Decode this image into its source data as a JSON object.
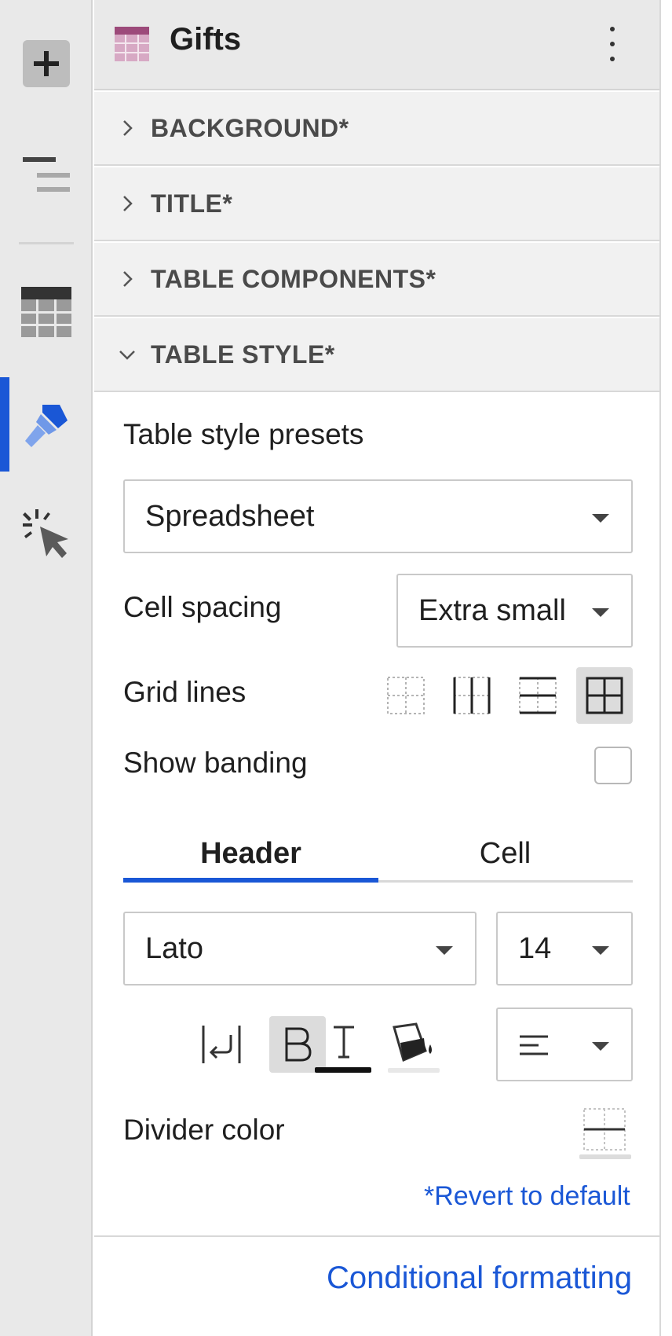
{
  "rail": {
    "items": [
      {
        "name": "add",
        "icon": "plus-icon"
      },
      {
        "name": "outline",
        "icon": "outline-lines-icon"
      },
      {
        "name": "table",
        "icon": "table-icon"
      },
      {
        "name": "format",
        "icon": "paintbrush-icon",
        "active": true
      },
      {
        "name": "actions",
        "icon": "cursor-click-icon"
      }
    ]
  },
  "header": {
    "title": "Gifts",
    "icon": "table-icon"
  },
  "sections": [
    {
      "label": "BACKGROUND*",
      "expanded": false
    },
    {
      "label": "TITLE*",
      "expanded": false
    },
    {
      "label": "TABLE COMPONENTS*",
      "expanded": false
    },
    {
      "label": "TABLE STYLE*",
      "expanded": true
    }
  ],
  "table_style": {
    "presets_label": "Table style presets",
    "preset_value": "Spreadsheet",
    "cell_spacing_label": "Cell spacing",
    "cell_spacing_value": "Extra small",
    "grid_lines_label": "Grid lines",
    "grid_options": [
      "none",
      "vertical",
      "horizontal",
      "all"
    ],
    "grid_selected": "all",
    "show_banding_label": "Show banding",
    "show_banding_checked": false,
    "tabs": [
      {
        "label": "Header",
        "active": true
      },
      {
        "label": "Cell",
        "active": false
      }
    ],
    "font_value": "Lato",
    "font_size_value": "14",
    "bold_active": true,
    "align_value": "left",
    "divider_color_label": "Divider color",
    "revert_label": "*Revert to default"
  },
  "footer": {
    "conditional_formatting_label": "Conditional formatting"
  },
  "colors": {
    "accent": "#1a57d6",
    "table_icon": "#9c4a7a"
  }
}
